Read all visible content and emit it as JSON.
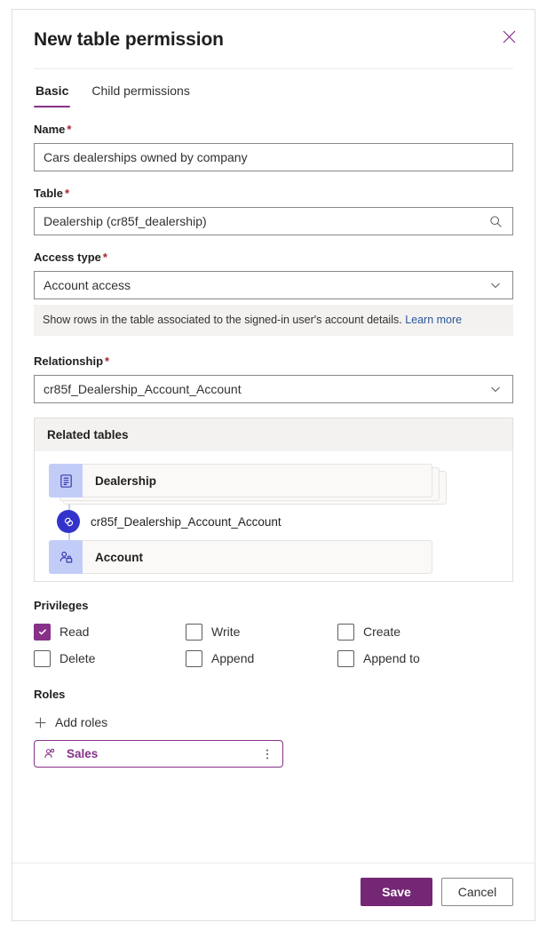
{
  "dialog": {
    "title": "New table permission",
    "close_icon": "close-icon"
  },
  "tabs": [
    {
      "label": "Basic",
      "active": true
    },
    {
      "label": "Child permissions",
      "active": false
    }
  ],
  "fields": {
    "name": {
      "label": "Name",
      "required": "*",
      "value": "Cars dealerships owned by company"
    },
    "table": {
      "label": "Table",
      "required": "*",
      "value": "Dealership (cr85f_dealership)",
      "affix_icon": "search-icon"
    },
    "access_type": {
      "label": "Access type",
      "required": "*",
      "value": "Account access",
      "affix_icon": "chevron-down-icon",
      "hint_text": "Show rows in the table associated to the signed-in user's account details.",
      "hint_link": "Learn more"
    },
    "relationship": {
      "label": "Relationship",
      "required": "*",
      "value": "cr85f_Dealership_Account_Account",
      "affix_icon": "chevron-down-icon"
    }
  },
  "related_tables": {
    "header": "Related tables",
    "source": {
      "label": "Dealership",
      "icon": "table-icon"
    },
    "relationship": {
      "label": "cr85f_Dealership_Account_Account",
      "icon": "link-icon"
    },
    "target": {
      "label": "Account",
      "icon": "account-icon"
    }
  },
  "privileges": {
    "label": "Privileges",
    "items": [
      {
        "label": "Read",
        "checked": true
      },
      {
        "label": "Write",
        "checked": false
      },
      {
        "label": "Create",
        "checked": false
      },
      {
        "label": "Delete",
        "checked": false
      },
      {
        "label": "Append",
        "checked": false
      },
      {
        "label": "Append to",
        "checked": false
      }
    ]
  },
  "roles": {
    "label": "Roles",
    "add_label": "Add roles",
    "add_icon": "plus-icon",
    "items": [
      {
        "label": "Sales",
        "icon": "person-role-icon",
        "more_icon": "more-vertical-icon"
      }
    ]
  },
  "footer": {
    "save_label": "Save",
    "cancel_label": "Cancel"
  },
  "colors": {
    "accent_purple": "#873189",
    "save_purple": "#742774",
    "link_blue": "#2b579a",
    "required_red": "#a4262c",
    "node_icon_bg": "#c2cdf7",
    "relationship_blue": "#3333cc"
  }
}
